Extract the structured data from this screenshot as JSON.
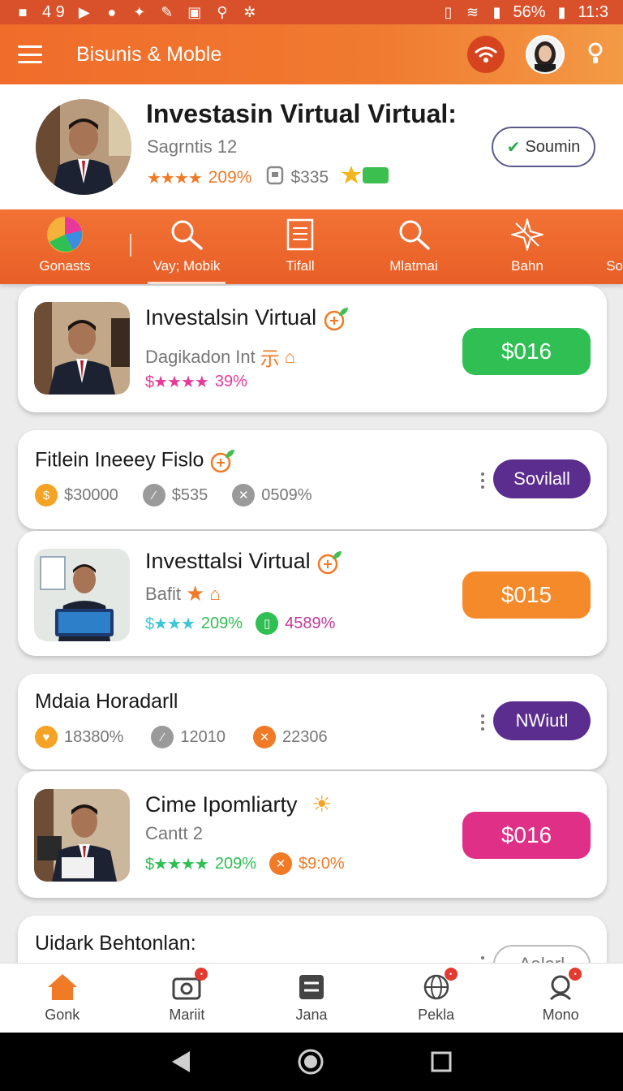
{
  "status_bar": {
    "left_text": "4 9",
    "battery": "56%",
    "time": "11:3"
  },
  "app_bar": {
    "title": "Bisunis & Moble"
  },
  "profile": {
    "name": "Investasin Virtual Virtual:",
    "subtitle": "Sagrntis 12",
    "rating_pct": "209%",
    "amount": "$335",
    "follow_label": "Soumin",
    "rating_stars": 4
  },
  "categories": [
    {
      "label": "Gonasts",
      "icon": "pie-chart-icon"
    },
    {
      "label": "Vay; Mobik",
      "icon": "search-icon"
    },
    {
      "label": "Tifall",
      "icon": "document-icon"
    },
    {
      "label": "Mlatmai",
      "icon": "search-icon"
    },
    {
      "label": "Bahn",
      "icon": "star-burst-icon"
    },
    {
      "label": "So",
      "icon": ""
    }
  ],
  "cards": [
    {
      "title": "Investalsin Virtual",
      "subtitle": "Dagikadon Int",
      "rating_pct": "39%",
      "price": "$016",
      "price_color": "#2fbf52",
      "stars_color": "#e8399a"
    },
    {
      "title": "Fitlein Ineeey Fislo",
      "stats": [
        "$30000",
        "$535",
        "0509%"
      ],
      "pill": "Sovilall"
    },
    {
      "title": "Investtalsi Virtual",
      "subtitle": "Bafit",
      "rating_pct": "209%",
      "extra": "4589%",
      "price": "$015",
      "price_color": "#f58a2a",
      "stars_color": "#3cc6d8"
    },
    {
      "title": "Mdaia Horadarll",
      "stats": [
        "18380%",
        "12010",
        "22306"
      ],
      "pill": "NWiutl"
    },
    {
      "title": "Cime Ipomliarty",
      "subtitle": "Cantt 2",
      "rating_pct": "209%",
      "extra": "$9:0%",
      "price": "$016",
      "price_color": "#e02f86",
      "stars_color": "#2fbf52"
    },
    {
      "title": "Uidark Behtonlan:",
      "pill": "Aalarl"
    }
  ],
  "bottom_nav": [
    {
      "label": "Gonk",
      "icon": "home-icon"
    },
    {
      "label": "Mariit",
      "icon": "camera-icon"
    },
    {
      "label": "Jana",
      "icon": "list-icon"
    },
    {
      "label": "Pekla",
      "icon": "globe-icon"
    },
    {
      "label": "Mono",
      "icon": "profile-icon"
    }
  ]
}
